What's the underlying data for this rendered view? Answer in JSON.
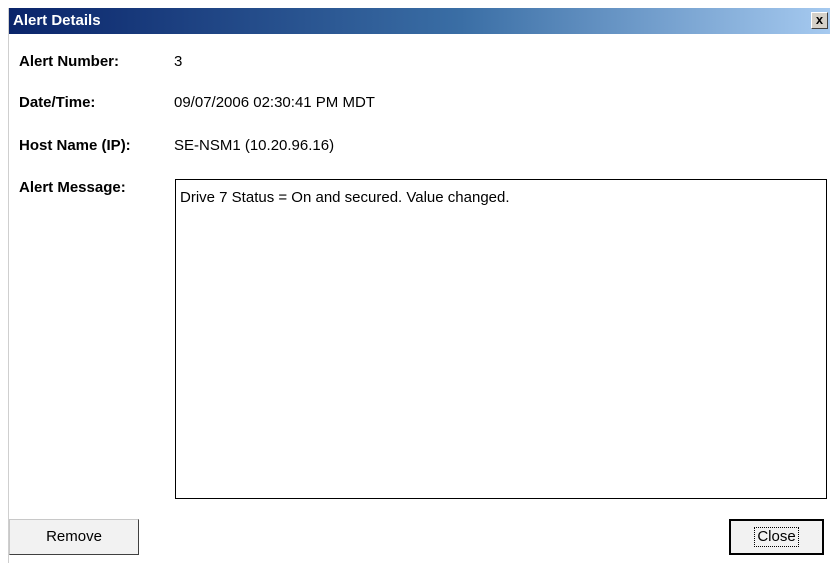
{
  "window": {
    "title": "Alert Details",
    "close_glyph": "x"
  },
  "fields": {
    "alert_number_label": "Alert Number:",
    "alert_number_value": "3",
    "datetime_label": "Date/Time:",
    "datetime_value": "09/07/2006 02:30:41 PM MDT",
    "host_label": "Host Name (IP):",
    "host_value": "SE-NSM1 (10.20.96.16)",
    "message_label": "Alert Message:",
    "message_value": "Drive 7 Status = On and secured. Value changed."
  },
  "buttons": {
    "remove_label": "Remove",
    "close_label": "Close"
  }
}
